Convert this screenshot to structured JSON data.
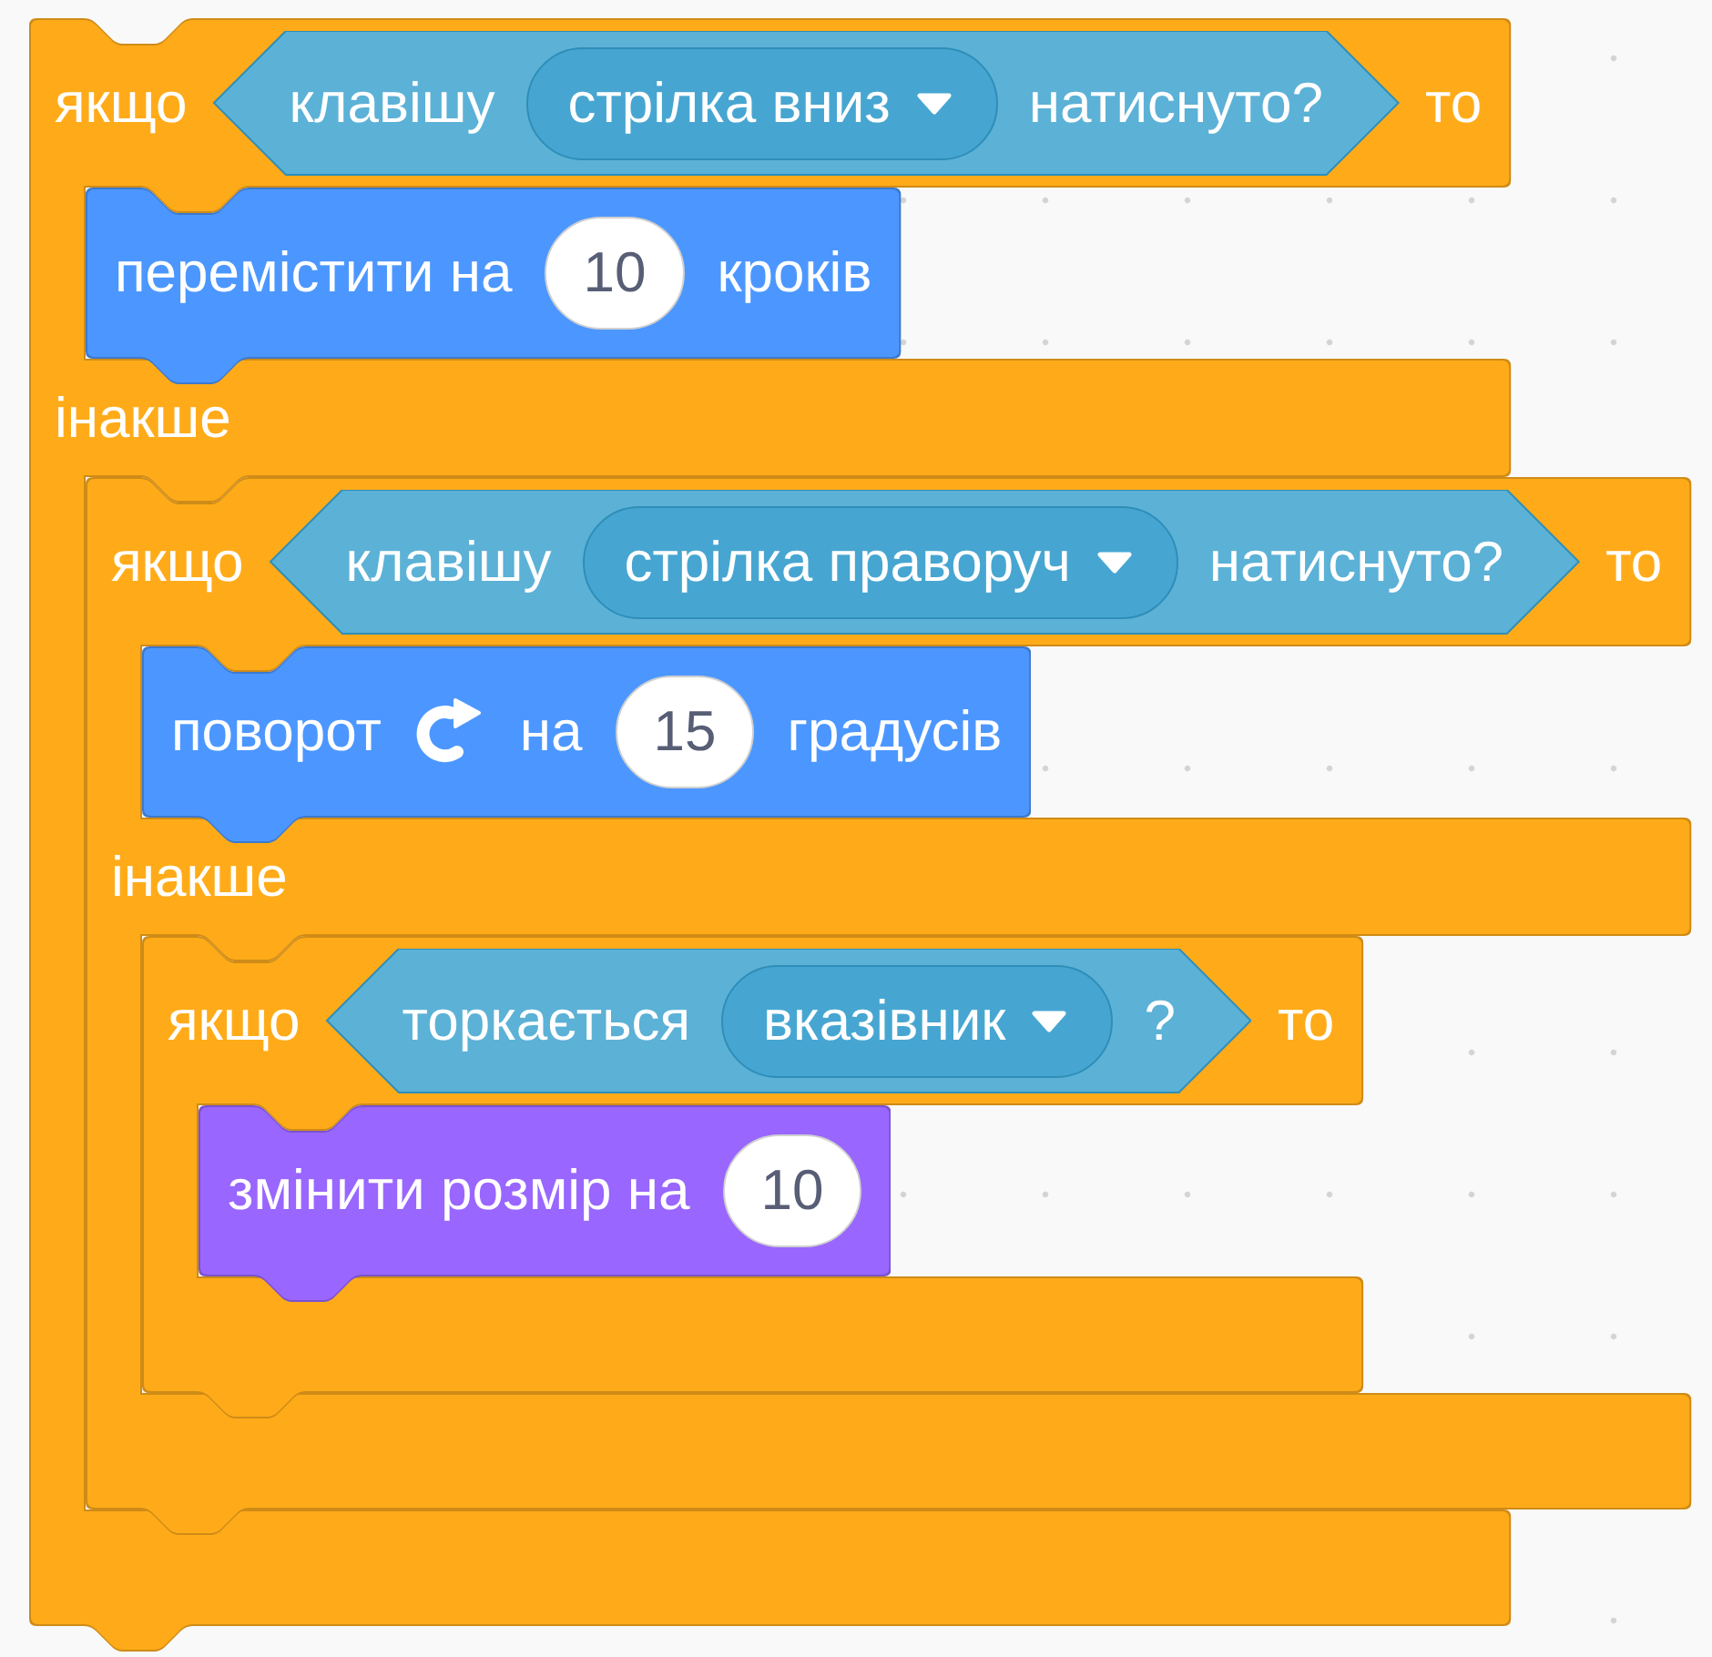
{
  "script": [
    {
      "kind": "if_else",
      "header": [
        {
          "kind": "label",
          "text": "якщо"
        },
        {
          "kind": "boolean",
          "parts": [
            {
              "kind": "label",
              "text": "клавішу"
            },
            {
              "kind": "dropdown",
              "value": "стрілка вниз"
            },
            {
              "kind": "label",
              "text": "натиснуто?"
            }
          ]
        },
        {
          "kind": "label",
          "text": "то"
        }
      ],
      "then": [
        {
          "kind": "stack",
          "color": "#4c97ff",
          "parts": [
            {
              "kind": "label",
              "text": "перемістити на"
            },
            {
              "kind": "number",
              "value": "10"
            },
            {
              "kind": "label",
              "text": "кроків"
            }
          ]
        }
      ],
      "else_label": "інакше",
      "else": [
        {
          "kind": "if_else",
          "header": [
            {
              "kind": "label",
              "text": "якщо"
            },
            {
              "kind": "boolean",
              "parts": [
                {
                  "kind": "label",
                  "text": "клавішу"
                },
                {
                  "kind": "dropdown",
                  "value": "стрілка праворуч"
                },
                {
                  "kind": "label",
                  "text": "натиснуто?"
                }
              ]
            },
            {
              "kind": "label",
              "text": "то"
            }
          ],
          "then": [
            {
              "kind": "stack",
              "color": "#4c97ff",
              "parts": [
                {
                  "kind": "label",
                  "text": "поворот"
                },
                {
                  "kind": "icon"
                },
                {
                  "kind": "label",
                  "text": "на"
                },
                {
                  "kind": "number",
                  "value": "15"
                },
                {
                  "kind": "label",
                  "text": "градусів"
                }
              ]
            }
          ],
          "else_label": "інакше",
          "else": [
            {
              "kind": "if",
              "header": [
                {
                  "kind": "label",
                  "text": "якщо"
                },
                {
                  "kind": "boolean",
                  "parts": [
                    {
                      "kind": "label",
                      "text": "торкається"
                    },
                    {
                      "kind": "dropdown",
                      "value": "вказівник"
                    },
                    {
                      "kind": "label",
                      "text": "?"
                    }
                  ]
                },
                {
                  "kind": "label",
                  "text": "то"
                }
              ],
              "then": [
                {
                  "kind": "stack",
                  "color": "#9966ff",
                  "parts": [
                    {
                      "kind": "label",
                      "text": "змінити розмір на"
                    },
                    {
                      "kind": "number",
                      "value": "10"
                    }
                  ]
                }
              ]
            }
          ]
        }
      ]
    }
  ]
}
